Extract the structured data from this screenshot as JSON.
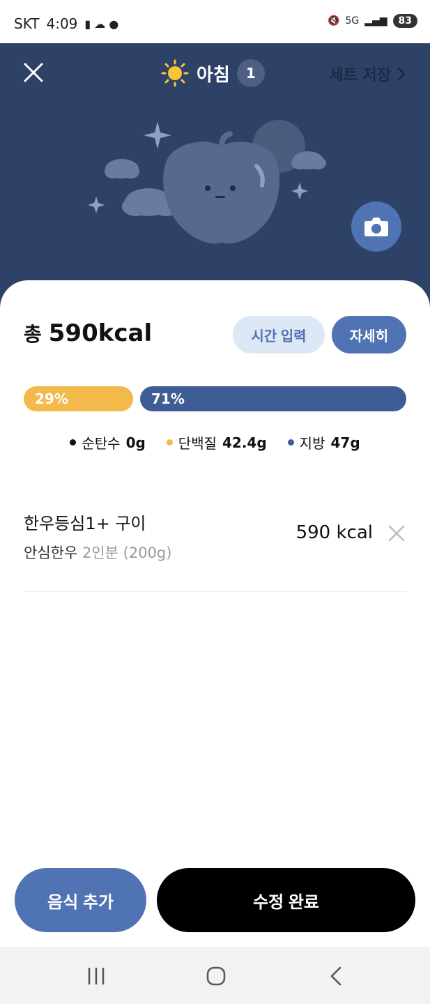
{
  "status_bar": {
    "carrier": "SKT",
    "time": "4:09",
    "battery": "83",
    "network": "5G"
  },
  "header": {
    "meal_title": "아침",
    "meal_count": "1",
    "set_save_label": "세트 저장"
  },
  "summary": {
    "total_label": "총",
    "total_value": "590kcal",
    "time_input_label": "시간 입력",
    "detail_label": "자세히"
  },
  "macro_bar": {
    "protein_percent_label": "29%",
    "fat_percent_label": "71%",
    "protein_fraction": 0.29,
    "fat_fraction": 0.71
  },
  "legend": [
    {
      "label": "순탄수",
      "value": "0g",
      "color": "#111111"
    },
    {
      "label": "단백질",
      "value": "42.4g",
      "color": "#f3b94b"
    },
    {
      "label": "지방",
      "value": "47g",
      "color": "#3f5d95"
    }
  ],
  "food": {
    "name": "한우등심1+ 구이",
    "brand": "안심한우",
    "portion": "2인분 (200g)",
    "kcal": "590 kcal"
  },
  "actions": {
    "add_food_label": "음식 추가",
    "complete_label": "수정 완료"
  },
  "colors": {
    "hero_bg": "#2e4268",
    "accent": "#4f73b3",
    "protein": "#f3b94b",
    "fat": "#3f5d95"
  }
}
